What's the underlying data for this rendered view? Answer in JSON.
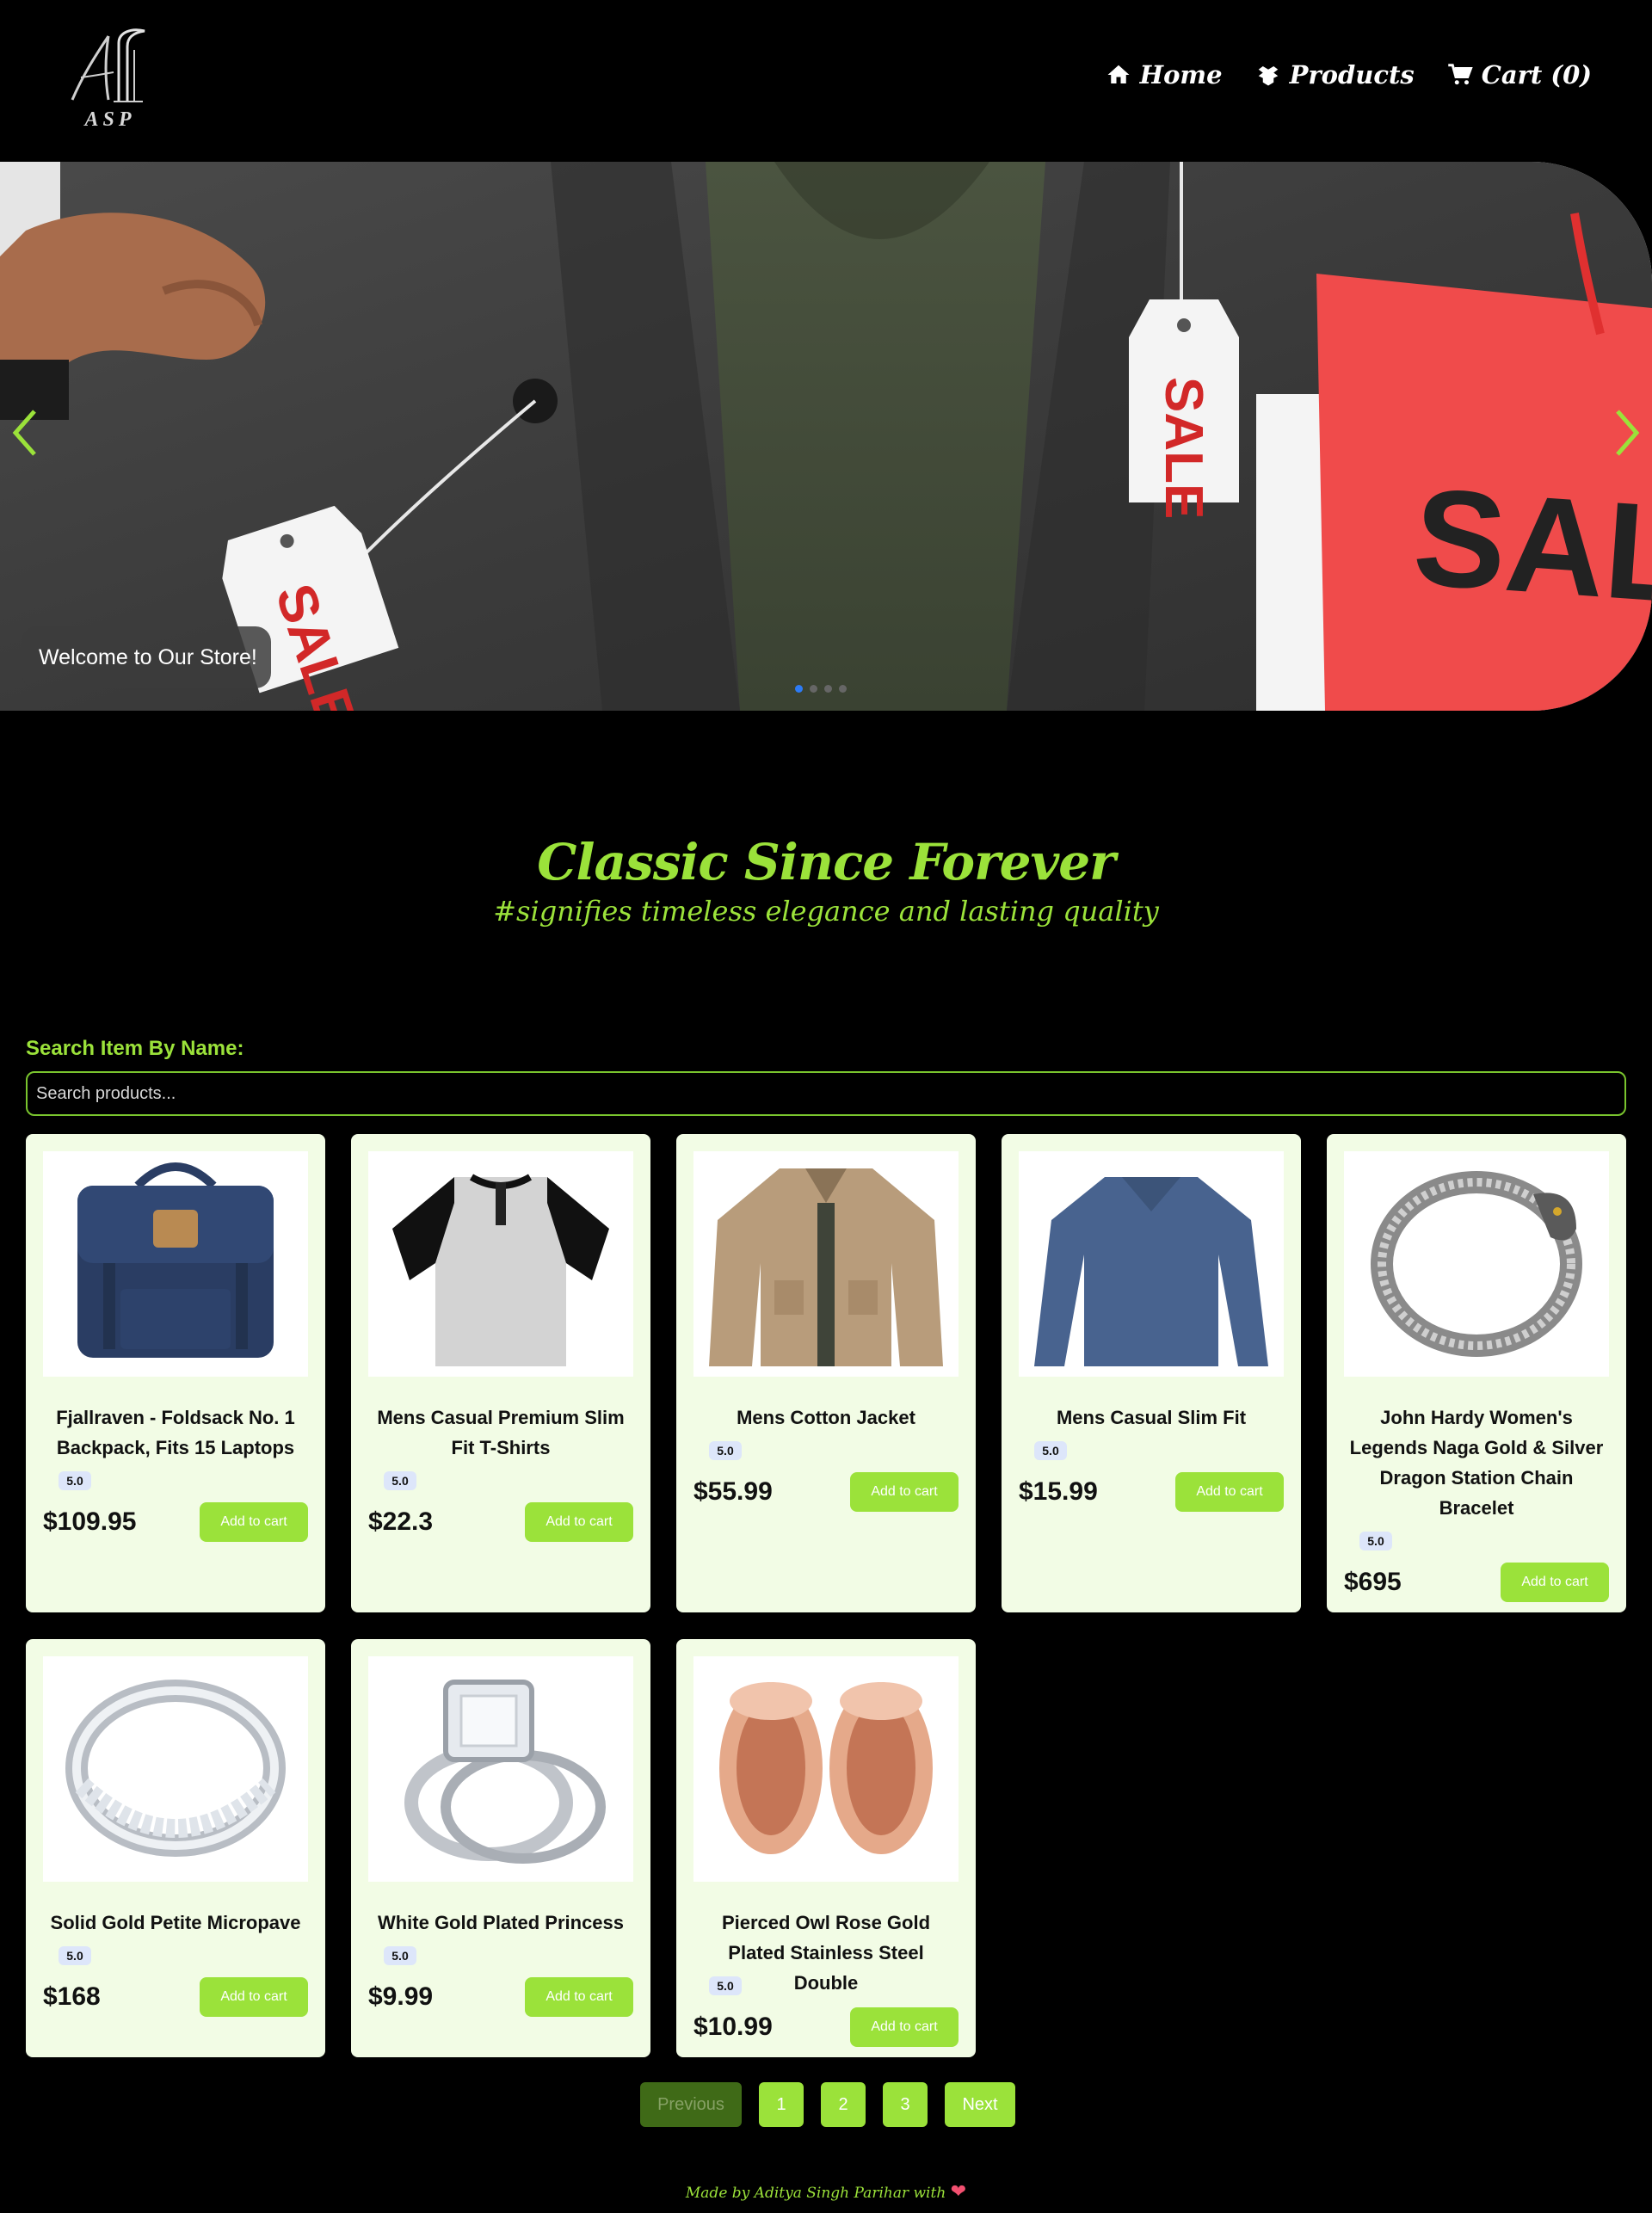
{
  "nav": {
    "logo_text": "ASP",
    "links": [
      {
        "label": "Home",
        "icon": "home-icon"
      },
      {
        "label": "Products",
        "icon": "box-icon"
      },
      {
        "label": "Cart (0)",
        "icon": "cart-icon"
      }
    ]
  },
  "hero": {
    "caption": "Welcome to Our Store!",
    "tag_text": "SALE",
    "bag_text": "SAL",
    "slide_count": 4,
    "active_slide": 1,
    "accent_color": "#9be23a"
  },
  "tagline": {
    "title": "Classic Since Forever",
    "subtitle": "#signifies timeless elegance and lasting quality"
  },
  "search": {
    "label": "Search Item By Name:",
    "placeholder": "Search products..."
  },
  "products": [
    {
      "title": "Fjallraven - Foldsack No. 1 Backpack, Fits 15 Laptops",
      "rating": "5.0",
      "price": "$109.95",
      "button": "Add to cart",
      "image": "backpack"
    },
    {
      "title": "Mens Casual Premium Slim Fit T-Shirts",
      "rating": "5.0",
      "price": "$22.3",
      "button": "Add to cart",
      "image": "raglan-tshirt"
    },
    {
      "title": "Mens Cotton Jacket",
      "rating": "5.0",
      "price": "$55.99",
      "button": "Add to cart",
      "image": "jacket"
    },
    {
      "title": "Mens Casual Slim Fit",
      "rating": "5.0",
      "price": "$15.99",
      "button": "Add to cart",
      "image": "longsleeve"
    },
    {
      "title": "John Hardy Women's Legends Naga Gold & Silver Dragon Station Chain Bracelet",
      "rating": "5.0",
      "price": "$695",
      "button": "Add to cart",
      "image": "bracelet"
    },
    {
      "title": "Solid Gold Petite Micropave",
      "rating": "5.0",
      "price": "$168",
      "button": "Add to cart",
      "image": "ring"
    },
    {
      "title": "White Gold Plated Princess",
      "rating": "5.0",
      "price": "$9.99",
      "button": "Add to cart",
      "image": "engagement-ring"
    },
    {
      "title": "Pierced Owl Rose Gold Plated Stainless Steel Double",
      "rating": "5.0",
      "price": "$10.99",
      "button": "Add to cart",
      "image": "plugs"
    }
  ],
  "pagination": {
    "previous": "Previous",
    "pages": [
      "1",
      "2",
      "3"
    ],
    "next": "Next"
  },
  "footer": {
    "text": "Made by Aditya Singh Parihar with",
    "heart": "❤"
  }
}
